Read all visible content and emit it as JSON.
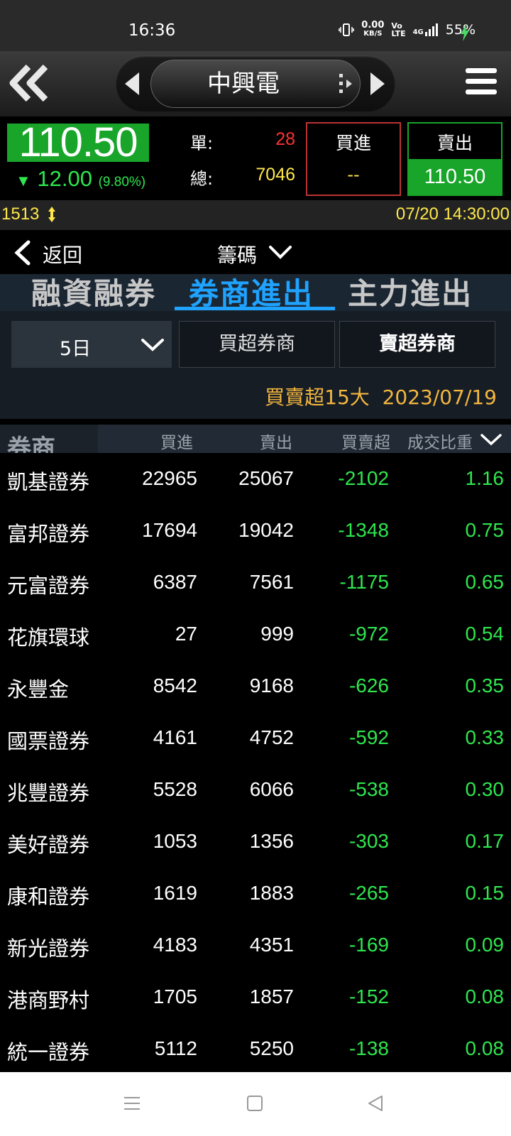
{
  "status_bar": {
    "time": "16:36",
    "net_speed_value": "0.00",
    "net_speed_unit": "KB/S",
    "volte_top": "Vo",
    "volte_bottom": "LTE",
    "network": "4G",
    "battery": "55%"
  },
  "header": {
    "stock_name": "中興電"
  },
  "quote": {
    "price": "110.50",
    "change": "12.00",
    "change_pct": "(9.80%)",
    "single_label": "單:",
    "single_value": "28",
    "total_label": "總:",
    "total_value": "7046",
    "buy_label": "買進",
    "buy_value": "--",
    "sell_label": "賣出",
    "sell_value": "110.50"
  },
  "ticker": {
    "code": "1513",
    "datetime": "07/20 14:30:00"
  },
  "subnav": {
    "back_label": "返回",
    "section_label": "籌碼"
  },
  "tabs": [
    {
      "label": "融資融券",
      "active": false
    },
    {
      "label": "券商進出",
      "active": true
    },
    {
      "label": "主力進出",
      "active": false
    }
  ],
  "filters": {
    "period": "5日",
    "buy_top_label": "買超券商",
    "sell_top_label": "賣超券商",
    "caption_title": "買賣超15大",
    "caption_date": "2023/07/19"
  },
  "table": {
    "headers": {
      "broker": "券商",
      "buy": "買進",
      "sell": "賣出",
      "net": "買賣超",
      "ratio": "成交比重"
    },
    "rows": [
      {
        "broker": "凱基證券",
        "buy": "22965",
        "sell": "25067",
        "net": "-2102",
        "ratio": "1.16"
      },
      {
        "broker": "富邦證券",
        "buy": "17694",
        "sell": "19042",
        "net": "-1348",
        "ratio": "0.75"
      },
      {
        "broker": "元富證券",
        "buy": "6387",
        "sell": "7561",
        "net": "-1175",
        "ratio": "0.65"
      },
      {
        "broker": "花旗環球",
        "buy": "27",
        "sell": "999",
        "net": "-972",
        "ratio": "0.54"
      },
      {
        "broker": "永豐金",
        "buy": "8542",
        "sell": "9168",
        "net": "-626",
        "ratio": "0.35"
      },
      {
        "broker": "國票證券",
        "buy": "4161",
        "sell": "4752",
        "net": "-592",
        "ratio": "0.33"
      },
      {
        "broker": "兆豐證券",
        "buy": "5528",
        "sell": "6066",
        "net": "-538",
        "ratio": "0.30"
      },
      {
        "broker": "美好證券",
        "buy": "1053",
        "sell": "1356",
        "net": "-303",
        "ratio": "0.17"
      },
      {
        "broker": "康和證券",
        "buy": "1619",
        "sell": "1883",
        "net": "-265",
        "ratio": "0.15"
      },
      {
        "broker": "新光證券",
        "buy": "4183",
        "sell": "4351",
        "net": "-169",
        "ratio": "0.09"
      },
      {
        "broker": "港商野村",
        "buy": "1705",
        "sell": "1857",
        "net": "-152",
        "ratio": "0.08"
      },
      {
        "broker": "統一證券",
        "buy": "5112",
        "sell": "5250",
        "net": "-138",
        "ratio": "0.08"
      }
    ]
  },
  "colors": {
    "up_red": "#ff3030",
    "down_green": "#2ee64e",
    "highlight_green": "#19a52a",
    "accent_blue": "#1fa3ff",
    "yellow": "#ffe94a",
    "orange": "#f4b63f"
  }
}
